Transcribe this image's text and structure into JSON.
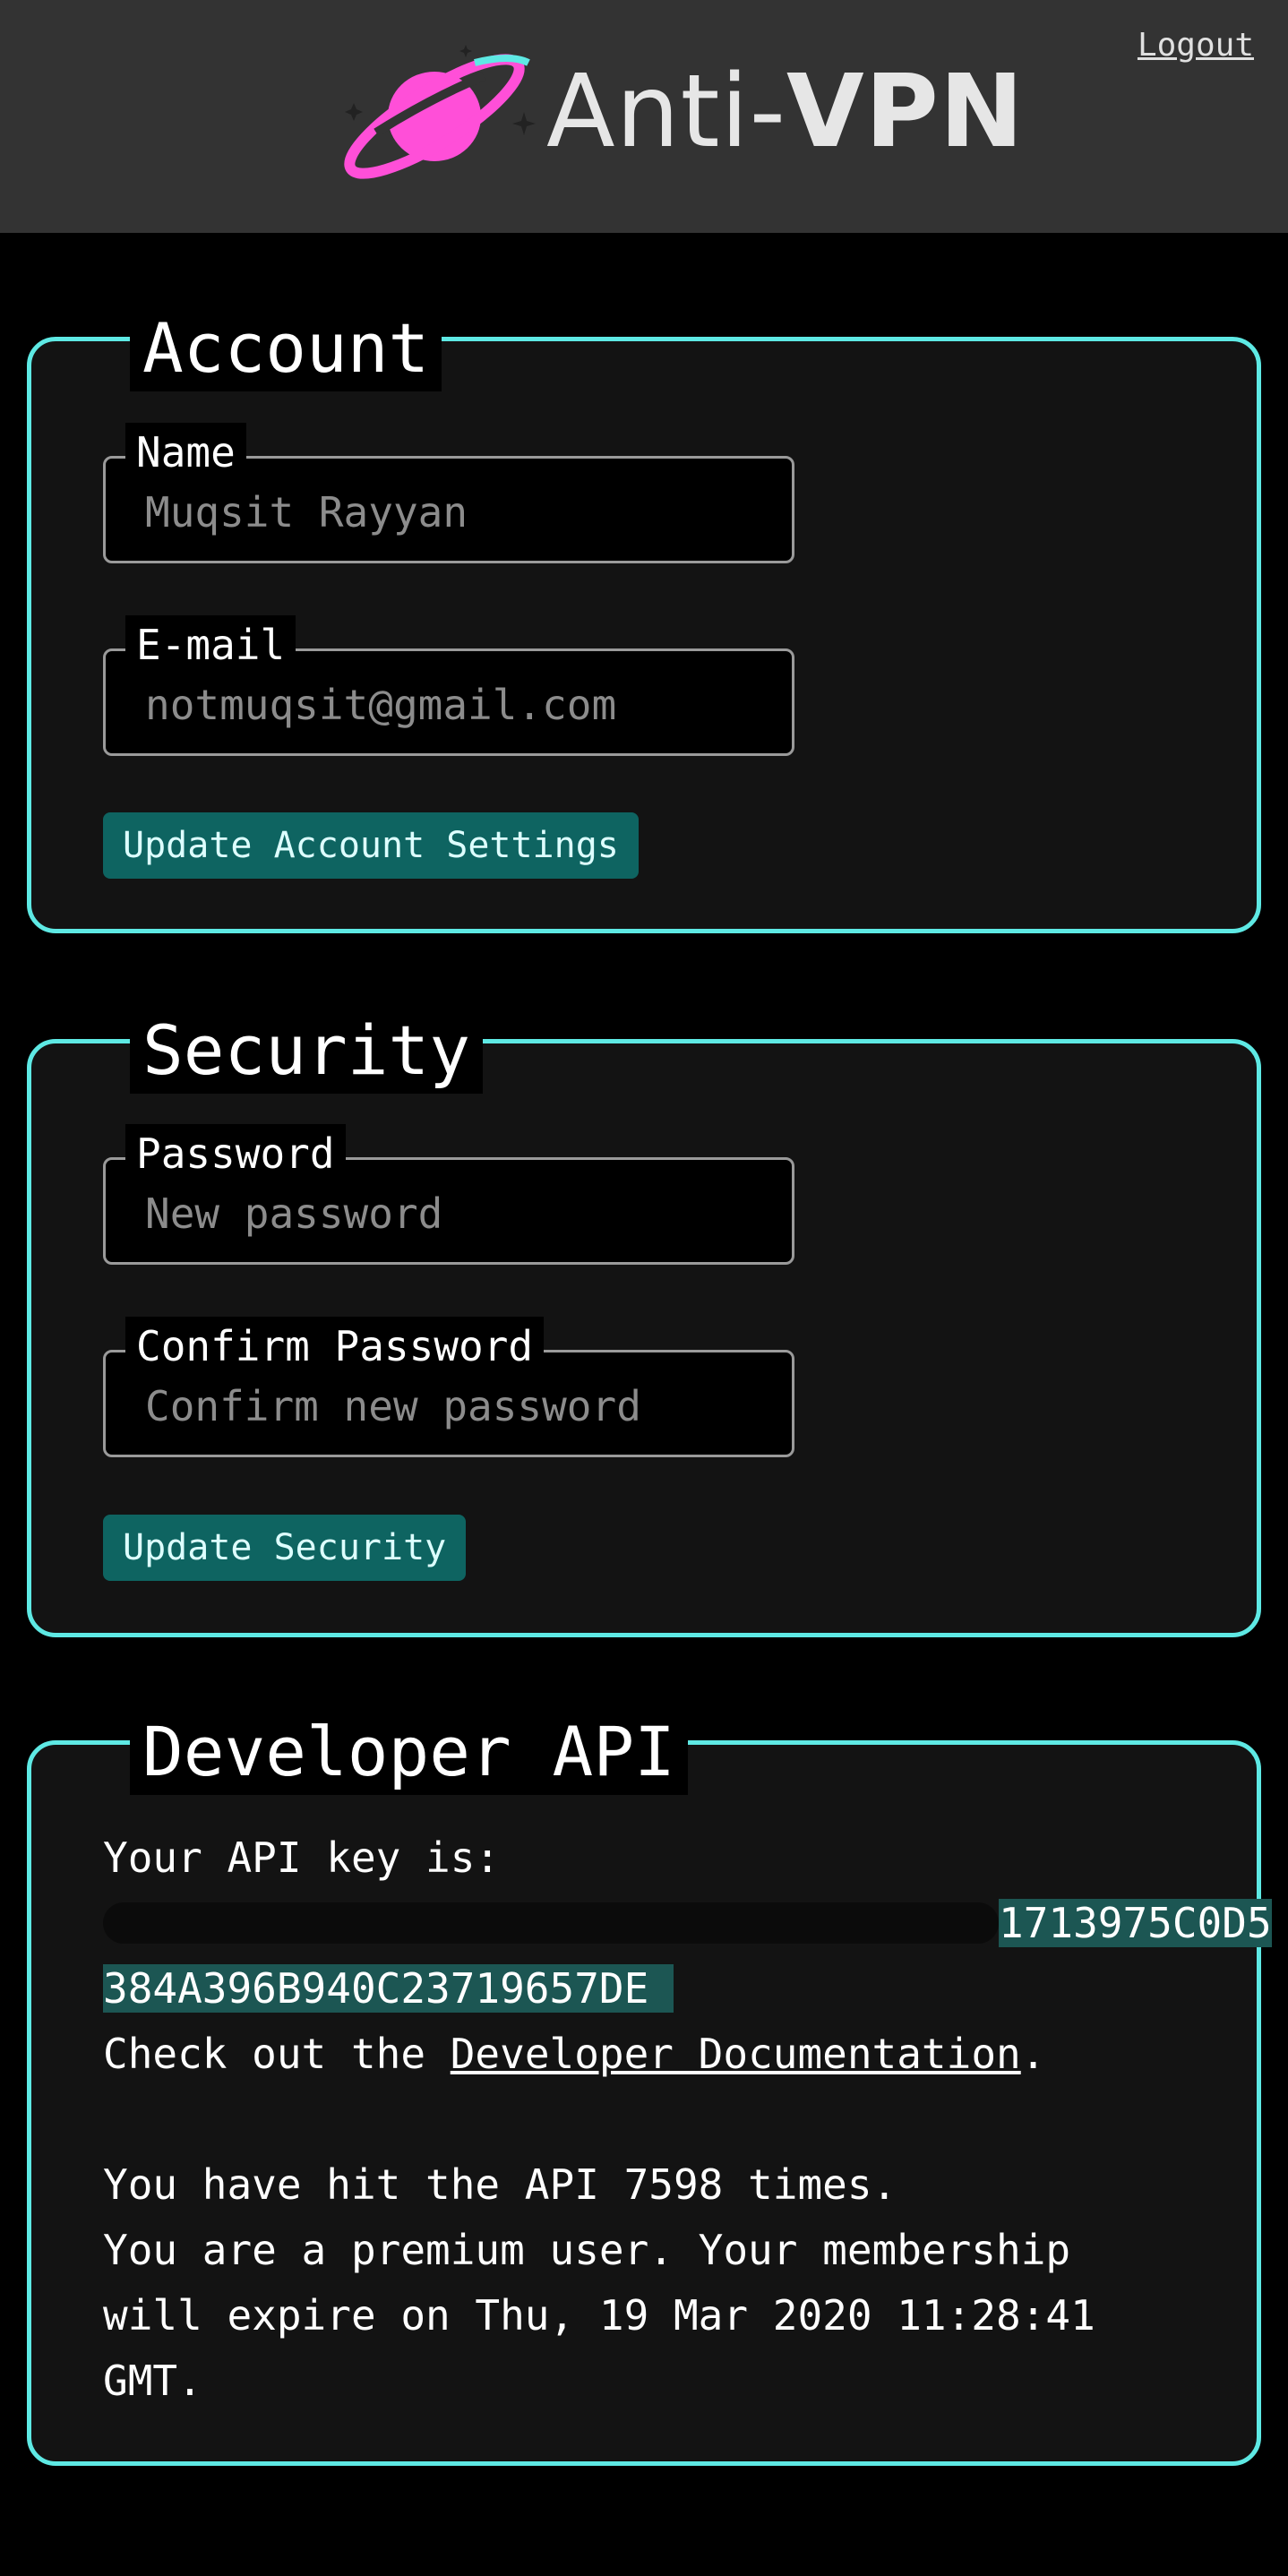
{
  "header": {
    "logo_text_light": "Anti-",
    "logo_text_bold": "VPN",
    "logout_label": "Logout"
  },
  "account": {
    "title": "Account",
    "name_label": "Name",
    "name_placeholder": "Muqsit Rayyan",
    "email_label": "E-mail",
    "email_placeholder": "notmuqsit@gmail.com",
    "button_label": "Update Account Settings"
  },
  "security": {
    "title": "Security",
    "password_label": "Password",
    "password_placeholder": "New password",
    "confirm_label": "Confirm Password",
    "confirm_placeholder": "Confirm new password",
    "button_label": "Update Security"
  },
  "api": {
    "title": "Developer API",
    "intro": "Your API key is:",
    "key_visible_end_line1": "1713975C0D5",
    "key_line2": "384A396B940C23719657DE",
    "doc_prefix": "Check out the ",
    "doc_link": "Developer Documentation",
    "doc_suffix": ".",
    "hits": "You have hit the API 7598 times.",
    "premium_line1": "You are a premium user. Your membership",
    "premium_line2": "will expire on Thu, 19 Mar 2020 11:28:41",
    "premium_line3": "GMT."
  },
  "colors": {
    "accent": "#5ee9e4",
    "button": "#0e6461",
    "logo_pink": "#ff4fd8"
  }
}
